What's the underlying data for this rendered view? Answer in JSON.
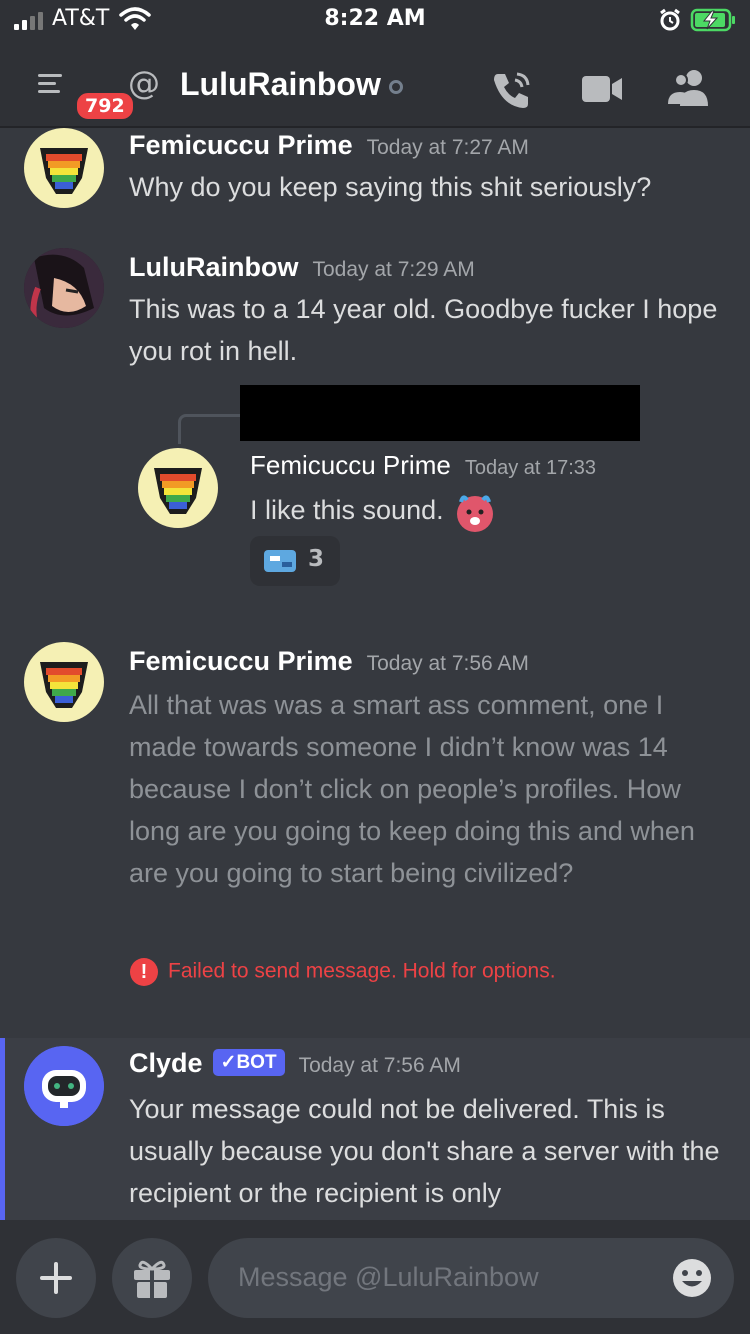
{
  "status_bar": {
    "carrier": "AT&T",
    "time": "8:22 AM"
  },
  "header": {
    "unread_badge": "792",
    "channel_name": "LuluRainbow"
  },
  "messages": [
    {
      "author": "Femicuccu Prime",
      "timestamp": "Today at 7:27 AM",
      "text": "Why do you keep saying this shit seriously?"
    },
    {
      "author": "LuluRainbow",
      "timestamp": "Today at 7:29 AM",
      "text": "This was to a 14 year old. Goodbye fucker I hope you rot in hell."
    },
    {
      "author": "Femicuccu Prime",
      "timestamp": "Today at 7:56 AM",
      "text": "All that was was a smart ass comment, one I made towards someone I didn’t know was 14 because I don’t click on people’s profiles. How long are you going to keep doing this and when are you going to start being civilized?",
      "error": "Failed to send message. Hold for options."
    },
    {
      "author": "Clyde",
      "tag": "✓BOT",
      "timestamp": "Today at 7:56 AM",
      "text": "Your message could not be delivered. This is usually because you don't share a server with the recipient or the recipient is only"
    }
  ],
  "embedded_screenshot": {
    "author": "Femicuccu Prime",
    "timestamp": "Today at 17:33",
    "text": "I like this sound.",
    "reaction_count": "3"
  },
  "composer": {
    "placeholder": "Message @LuluRainbow"
  }
}
